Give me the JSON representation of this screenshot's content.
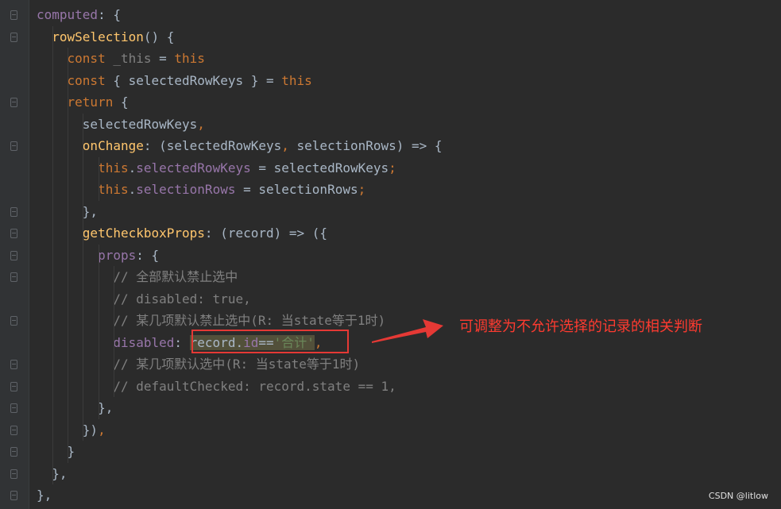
{
  "editor": {
    "lines": [
      [
        {
          "t": "computed",
          "c": "prop"
        },
        {
          "t": ": {",
          "c": "plain"
        }
      ],
      [
        {
          "t": "  ",
          "c": "plain"
        },
        {
          "t": "rowSelection",
          "c": "fn"
        },
        {
          "t": "() {",
          "c": "plain"
        }
      ],
      [
        {
          "t": "    ",
          "c": "plain"
        },
        {
          "t": "const ",
          "c": "kw"
        },
        {
          "t": "_this",
          "c": "cm"
        },
        {
          "t": " = ",
          "c": "plain"
        },
        {
          "t": "this",
          "c": "kw"
        }
      ],
      [
        {
          "t": "    ",
          "c": "plain"
        },
        {
          "t": "const ",
          "c": "kw"
        },
        {
          "t": "{ selectedRowKeys } = ",
          "c": "plain"
        },
        {
          "t": "this",
          "c": "kw"
        }
      ],
      [
        {
          "t": "    ",
          "c": "plain"
        },
        {
          "t": "return ",
          "c": "kw"
        },
        {
          "t": "{",
          "c": "plain"
        }
      ],
      [
        {
          "t": "      selectedRowKeys",
          "c": "plain"
        },
        {
          "t": ",",
          "c": "kw"
        }
      ],
      [
        {
          "t": "      ",
          "c": "plain"
        },
        {
          "t": "onChange",
          "c": "fn"
        },
        {
          "t": ": (selectedRowKeys",
          "c": "plain"
        },
        {
          "t": ", ",
          "c": "kw"
        },
        {
          "t": "selectionRows) => {",
          "c": "plain"
        }
      ],
      [
        {
          "t": "        ",
          "c": "plain"
        },
        {
          "t": "this",
          "c": "kw"
        },
        {
          "t": ".",
          "c": "plain"
        },
        {
          "t": "selectedRowKeys",
          "c": "prop"
        },
        {
          "t": " = selectedRowKeys",
          "c": "plain"
        },
        {
          "t": ";",
          "c": "kw"
        }
      ],
      [
        {
          "t": "        ",
          "c": "plain"
        },
        {
          "t": "this",
          "c": "kw"
        },
        {
          "t": ".",
          "c": "plain"
        },
        {
          "t": "selectionRows",
          "c": "prop"
        },
        {
          "t": " = selectionRows",
          "c": "plain"
        },
        {
          "t": ";",
          "c": "kw"
        }
      ],
      [
        {
          "t": "      },",
          "c": "plain"
        }
      ],
      [
        {
          "t": "      ",
          "c": "plain"
        },
        {
          "t": "getCheckboxProps",
          "c": "fn"
        },
        {
          "t": ": (record) => ({",
          "c": "plain"
        }
      ],
      [
        {
          "t": "        ",
          "c": "plain"
        },
        {
          "t": "props",
          "c": "prop"
        },
        {
          "t": ": {",
          "c": "plain"
        }
      ],
      [
        {
          "t": "          ",
          "c": "plain"
        },
        {
          "t": "// 全部默认禁止选中",
          "c": "cm"
        }
      ],
      [
        {
          "t": "          ",
          "c": "plain"
        },
        {
          "t": "// disabled: true,",
          "c": "cm"
        }
      ],
      [
        {
          "t": "          ",
          "c": "plain"
        },
        {
          "t": "// 某几项默认禁止选中(R: 当state等于1时)",
          "c": "cm"
        }
      ],
      [
        {
          "t": "          ",
          "c": "plain"
        },
        {
          "t": "disabled",
          "c": "prop"
        },
        {
          "t": ": ",
          "c": "plain"
        },
        {
          "t": "record.",
          "c": "plain",
          "hl": true
        },
        {
          "t": "id",
          "c": "prop",
          "hl": true
        },
        {
          "t": "==",
          "c": "plain",
          "hl": true
        },
        {
          "t": "'合计'",
          "c": "str",
          "hl": true
        },
        {
          "t": ",",
          "c": "kw"
        }
      ],
      [
        {
          "t": "          ",
          "c": "plain"
        },
        {
          "t": "// 某几项默认选中(R: 当state等于1时)",
          "c": "cm"
        }
      ],
      [
        {
          "t": "          ",
          "c": "plain"
        },
        {
          "t": "// defaultChecked: record.state == 1,",
          "c": "cm"
        }
      ],
      [
        {
          "t": "        },",
          "c": "plain"
        }
      ],
      [
        {
          "t": "      })",
          "c": "plain"
        },
        {
          "t": ",",
          "c": "kw"
        }
      ],
      [
        {
          "t": "    }",
          "c": "plain"
        }
      ],
      [
        {
          "t": "  },",
          "c": "plain"
        }
      ],
      [
        {
          "t": "},",
          "c": "plain"
        }
      ]
    ],
    "fold_markers": [
      {
        "line": 0,
        "kind": "open"
      },
      {
        "line": 1,
        "kind": "open"
      },
      {
        "line": 4,
        "kind": "open"
      },
      {
        "line": 6,
        "kind": "open"
      },
      {
        "line": 9,
        "kind": "close"
      },
      {
        "line": 10,
        "kind": "open"
      },
      {
        "line": 11,
        "kind": "open"
      },
      {
        "line": 12,
        "kind": "open"
      },
      {
        "line": 14,
        "kind": "close"
      },
      {
        "line": 16,
        "kind": "open"
      },
      {
        "line": 17,
        "kind": "close"
      },
      {
        "line": 18,
        "kind": "close"
      },
      {
        "line": 19,
        "kind": "close"
      },
      {
        "line": 20,
        "kind": "close"
      },
      {
        "line": 21,
        "kind": "close"
      },
      {
        "line": 22,
        "kind": "close"
      }
    ]
  },
  "annotation": {
    "text": "可调整为不允许选择的记录的相关判断",
    "color": "#e53935"
  },
  "watermark": "CSDN @litlow",
  "colors": {
    "background": "#2b2b2b",
    "keyword": "#cc7832",
    "function": "#ffc66d",
    "property": "#9876aa",
    "comment": "#808080",
    "string": "#6a8759"
  }
}
